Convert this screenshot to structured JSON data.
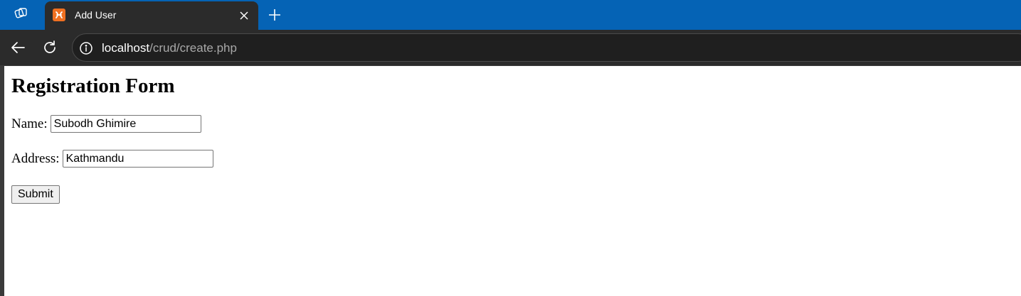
{
  "tab": {
    "title": "Add User",
    "favicon_icon": "xampp-icon",
    "favicon_color": "#f07021"
  },
  "browser": {
    "tabbar_color": "#0563b5",
    "toolbar_color": "#2b2b2b",
    "url_host": "localhost",
    "url_path": "/crud/create.php"
  },
  "page": {
    "title": "Registration Form",
    "name_label": "Name:",
    "name_value": "Subodh Ghimire",
    "address_label": "Address:",
    "address_value": "Kathmandu",
    "submit_label": "Submit"
  }
}
